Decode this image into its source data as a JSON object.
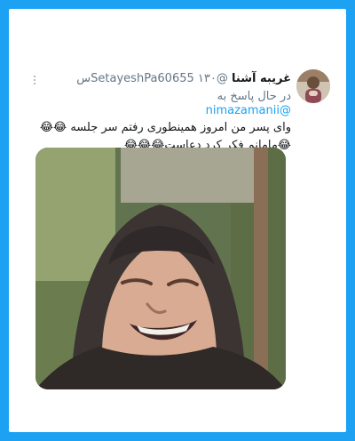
{
  "tweet": {
    "author_name": "غریبه آشنا",
    "handle": "@SetayeshPa60655",
    "time": "۱۳۰س",
    "replying_prefix": "در حال پاسخ به",
    "reply_mention": "@nimazamanii",
    "text_line1": "وای پسر من امروز همینطوری رفتم سر جلسه 😂😂",
    "text_line2": "😂مامانم فکر کرد دعاست😂😂😂"
  },
  "icons": {
    "more": "more-vertical-icon",
    "avatar": "user-avatar",
    "media": "tweet-photo"
  },
  "colors": {
    "background": "#1da1f2",
    "card": "#ffffff",
    "mention": "#1da1f2",
    "text": "#14171a",
    "secondary": "#657786"
  }
}
